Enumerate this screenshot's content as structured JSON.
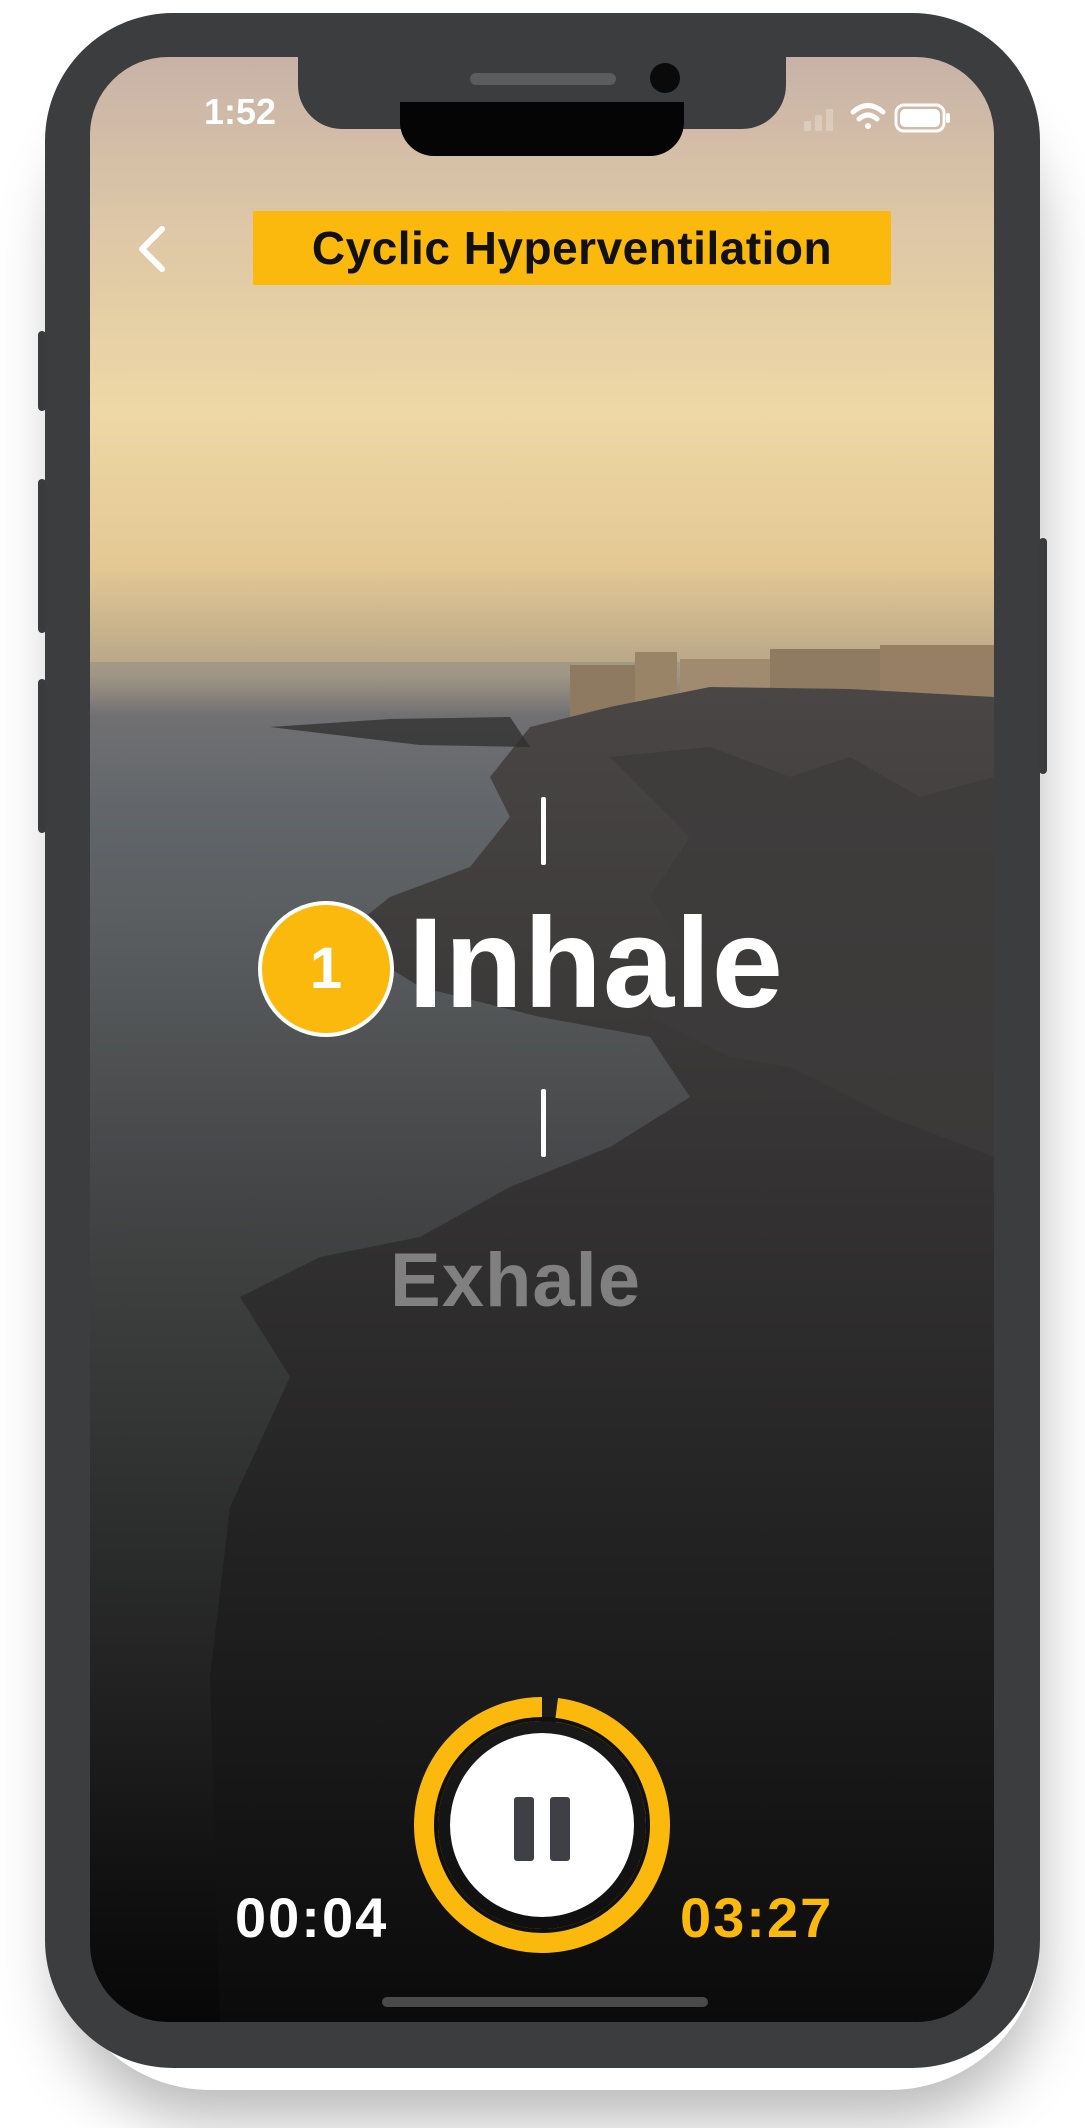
{
  "status_bar": {
    "time": "1:52"
  },
  "header": {
    "title": "Cyclic Hyperventilation",
    "back_icon": "chevron-left-icon"
  },
  "breathing": {
    "count": "1",
    "current_phase": "Inhale",
    "next_phase": "Exhale"
  },
  "player": {
    "elapsed": "00:04",
    "remaining": "03:27",
    "progress": 0.02,
    "control_icon": "pause-icon"
  },
  "colors": {
    "accent": "#fbb90e",
    "text": "#ffffff",
    "device": "#3c3d3f"
  }
}
